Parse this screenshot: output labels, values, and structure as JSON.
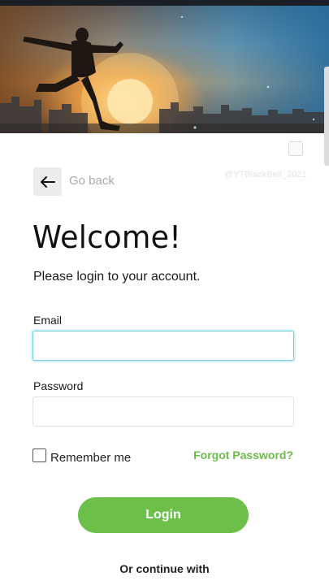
{
  "header": {
    "back_label": "Go back",
    "watermark": "@YTBlackBelt_2021"
  },
  "login": {
    "title": "Welcome!",
    "subtitle": "Please login to your account.",
    "email_label": "Email",
    "email_value": "",
    "password_label": "Password",
    "password_value": "",
    "remember_label": "Remember me",
    "remember_checked": false,
    "forgot_label": "Forgot Password?",
    "login_button": "Login",
    "continue_label": "Or continue with"
  },
  "colors": {
    "accent_green": "#6cc04a",
    "focus_ring": "#75cfd8",
    "muted_text": "#a9a9a9"
  },
  "icons": {
    "back": "arrow-left-icon"
  }
}
